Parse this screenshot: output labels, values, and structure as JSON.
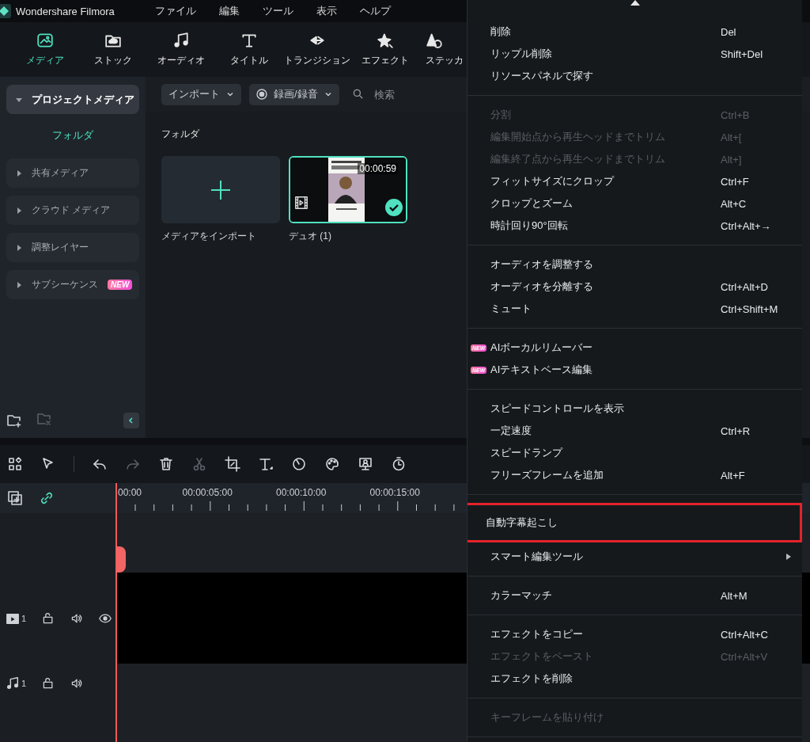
{
  "app": {
    "title": "Wondershare Filmora"
  },
  "menubar": [
    "ファイル",
    "編集",
    "ツール",
    "表示",
    "ヘルプ"
  ],
  "tabs": [
    {
      "label": "メディア",
      "selected": true
    },
    {
      "label": "ストック",
      "selected": false
    },
    {
      "label": "オーディオ",
      "selected": false
    },
    {
      "label": "タイトル",
      "selected": false
    },
    {
      "label": "トランジション",
      "selected": false
    },
    {
      "label": "エフェクト",
      "selected": false
    },
    {
      "label": "ステッカ",
      "selected": false
    }
  ],
  "sidebar": {
    "project": {
      "label": "プロジェクトメディア",
      "expanded": true
    },
    "folder": {
      "label": "フォルダ",
      "selected": true
    },
    "items": [
      {
        "label": "共有メディア",
        "expanded": false
      },
      {
        "label": "クラウド メディア",
        "expanded": false
      },
      {
        "label": "調整レイヤー",
        "expanded": false
      },
      {
        "label": "サブシーケンス",
        "expanded": false,
        "badge": "NEW"
      }
    ]
  },
  "media_toolbar": {
    "import": "インポート",
    "record": "録画/録音",
    "search": {
      "placeholder": "検索"
    }
  },
  "media": {
    "heading": "フォルダ",
    "items": [
      {
        "kind": "import",
        "label": "メディアをインポート",
        "selected": false
      },
      {
        "kind": "clip",
        "label": "デュオ (1)",
        "duration": "00:00:59",
        "selected": true
      }
    ]
  },
  "timeline_tools": [
    {
      "kind": "layout",
      "disabled": false
    },
    {
      "kind": "select",
      "disabled": false
    },
    {
      "kind": "undo",
      "disabled": false
    },
    {
      "kind": "redo",
      "disabled": true
    },
    {
      "kind": "delete",
      "disabled": false
    },
    {
      "kind": "cut",
      "disabled": true
    },
    {
      "kind": "crop",
      "disabled": false
    },
    {
      "kind": "text",
      "disabled": false
    },
    {
      "kind": "speed",
      "disabled": false
    },
    {
      "kind": "color",
      "disabled": false
    },
    {
      "kind": "presenter",
      "disabled": false
    },
    {
      "kind": "timer",
      "disabled": false
    }
  ],
  "timeline": {
    "ruler": [
      "00:00",
      "00:00:05:00",
      "00:00:10:00",
      "00:00:15:00"
    ],
    "tracks": [
      {
        "kind": "video",
        "number": "1"
      },
      {
        "kind": "audio",
        "number": "1"
      }
    ]
  },
  "context_menu": {
    "sections": [
      [
        {
          "label": "削除",
          "shortcut": "Del",
          "kind": "command",
          "disabled": false,
          "annotated": false
        },
        {
          "label": "リップル削除",
          "shortcut": "Shift+Del",
          "kind": "command",
          "disabled": false,
          "annotated": false
        },
        {
          "label": "リソースパネルで探す",
          "kind": "command",
          "disabled": false,
          "annotated": false
        }
      ],
      [
        {
          "label": "分割",
          "shortcut": "Ctrl+B",
          "kind": "command",
          "disabled": true,
          "annotated": false
        },
        {
          "label": "編集開始点から再生ヘッドまでトリム",
          "shortcut": "Alt+[",
          "kind": "command",
          "disabled": true,
          "annotated": false
        },
        {
          "label": "編集終了点から再生ヘッドまでトリム",
          "shortcut": "Alt+]",
          "kind": "command",
          "disabled": true,
          "annotated": false
        },
        {
          "label": "フィットサイズにクロップ",
          "shortcut": "Ctrl+F",
          "kind": "command",
          "disabled": false,
          "annotated": false
        },
        {
          "label": "クロップとズーム",
          "shortcut": "Alt+C",
          "kind": "command",
          "disabled": false,
          "annotated": false
        },
        {
          "label": "時計回り90°回転",
          "shortcut": "Ctrl+Alt+→",
          "kind": "command",
          "disabled": false,
          "annotated": false
        }
      ],
      [
        {
          "label": "オーディオを調整する",
          "kind": "command",
          "disabled": false,
          "annotated": false
        },
        {
          "label": "オーディオを分離する",
          "shortcut": "Ctrl+Alt+D",
          "kind": "command",
          "disabled": false,
          "annotated": false
        },
        {
          "label": "ミュート",
          "shortcut": "Ctrl+Shift+M",
          "kind": "command",
          "disabled": false,
          "annotated": false
        }
      ],
      [
        {
          "label": "AIボーカルリムーバー",
          "badge": "NEW",
          "kind": "command",
          "disabled": false,
          "annotated": false
        },
        {
          "label": "AIテキストベース編集",
          "badge": "NEW",
          "kind": "command",
          "disabled": false,
          "annotated": false
        }
      ],
      [
        {
          "label": "スピードコントロールを表示",
          "kind": "command",
          "disabled": false,
          "annotated": false
        },
        {
          "label": "一定速度",
          "shortcut": "Ctrl+R",
          "kind": "command",
          "disabled": false,
          "annotated": false
        },
        {
          "label": "スピードランプ",
          "kind": "command",
          "disabled": false,
          "annotated": false
        },
        {
          "label": "フリーズフレームを追加",
          "shortcut": "Alt+F",
          "kind": "command",
          "disabled": false,
          "annotated": false
        }
      ],
      [
        {
          "label": "自動字幕起こし",
          "kind": "command",
          "disabled": false,
          "annotated": true
        },
        {
          "label": "スマート編集ツール",
          "kind": "submenu",
          "disabled": false,
          "annotated": false
        }
      ],
      [
        {
          "label": "カラーマッチ",
          "shortcut": "Alt+M",
          "kind": "command",
          "disabled": false,
          "annotated": false
        }
      ],
      [
        {
          "label": "エフェクトをコピー",
          "shortcut": "Ctrl+Alt+C",
          "kind": "command",
          "disabled": false,
          "annotated": false
        },
        {
          "label": "エフェクトをペースト",
          "shortcut": "Ctrl+Alt+V",
          "kind": "command",
          "disabled": true,
          "annotated": false
        },
        {
          "label": "エフェクトを削除",
          "kind": "command",
          "disabled": false,
          "annotated": false
        }
      ],
      [
        {
          "label": "キーフレームを貼り付け",
          "kind": "command",
          "disabled": true,
          "annotated": false
        }
      ]
    ]
  }
}
